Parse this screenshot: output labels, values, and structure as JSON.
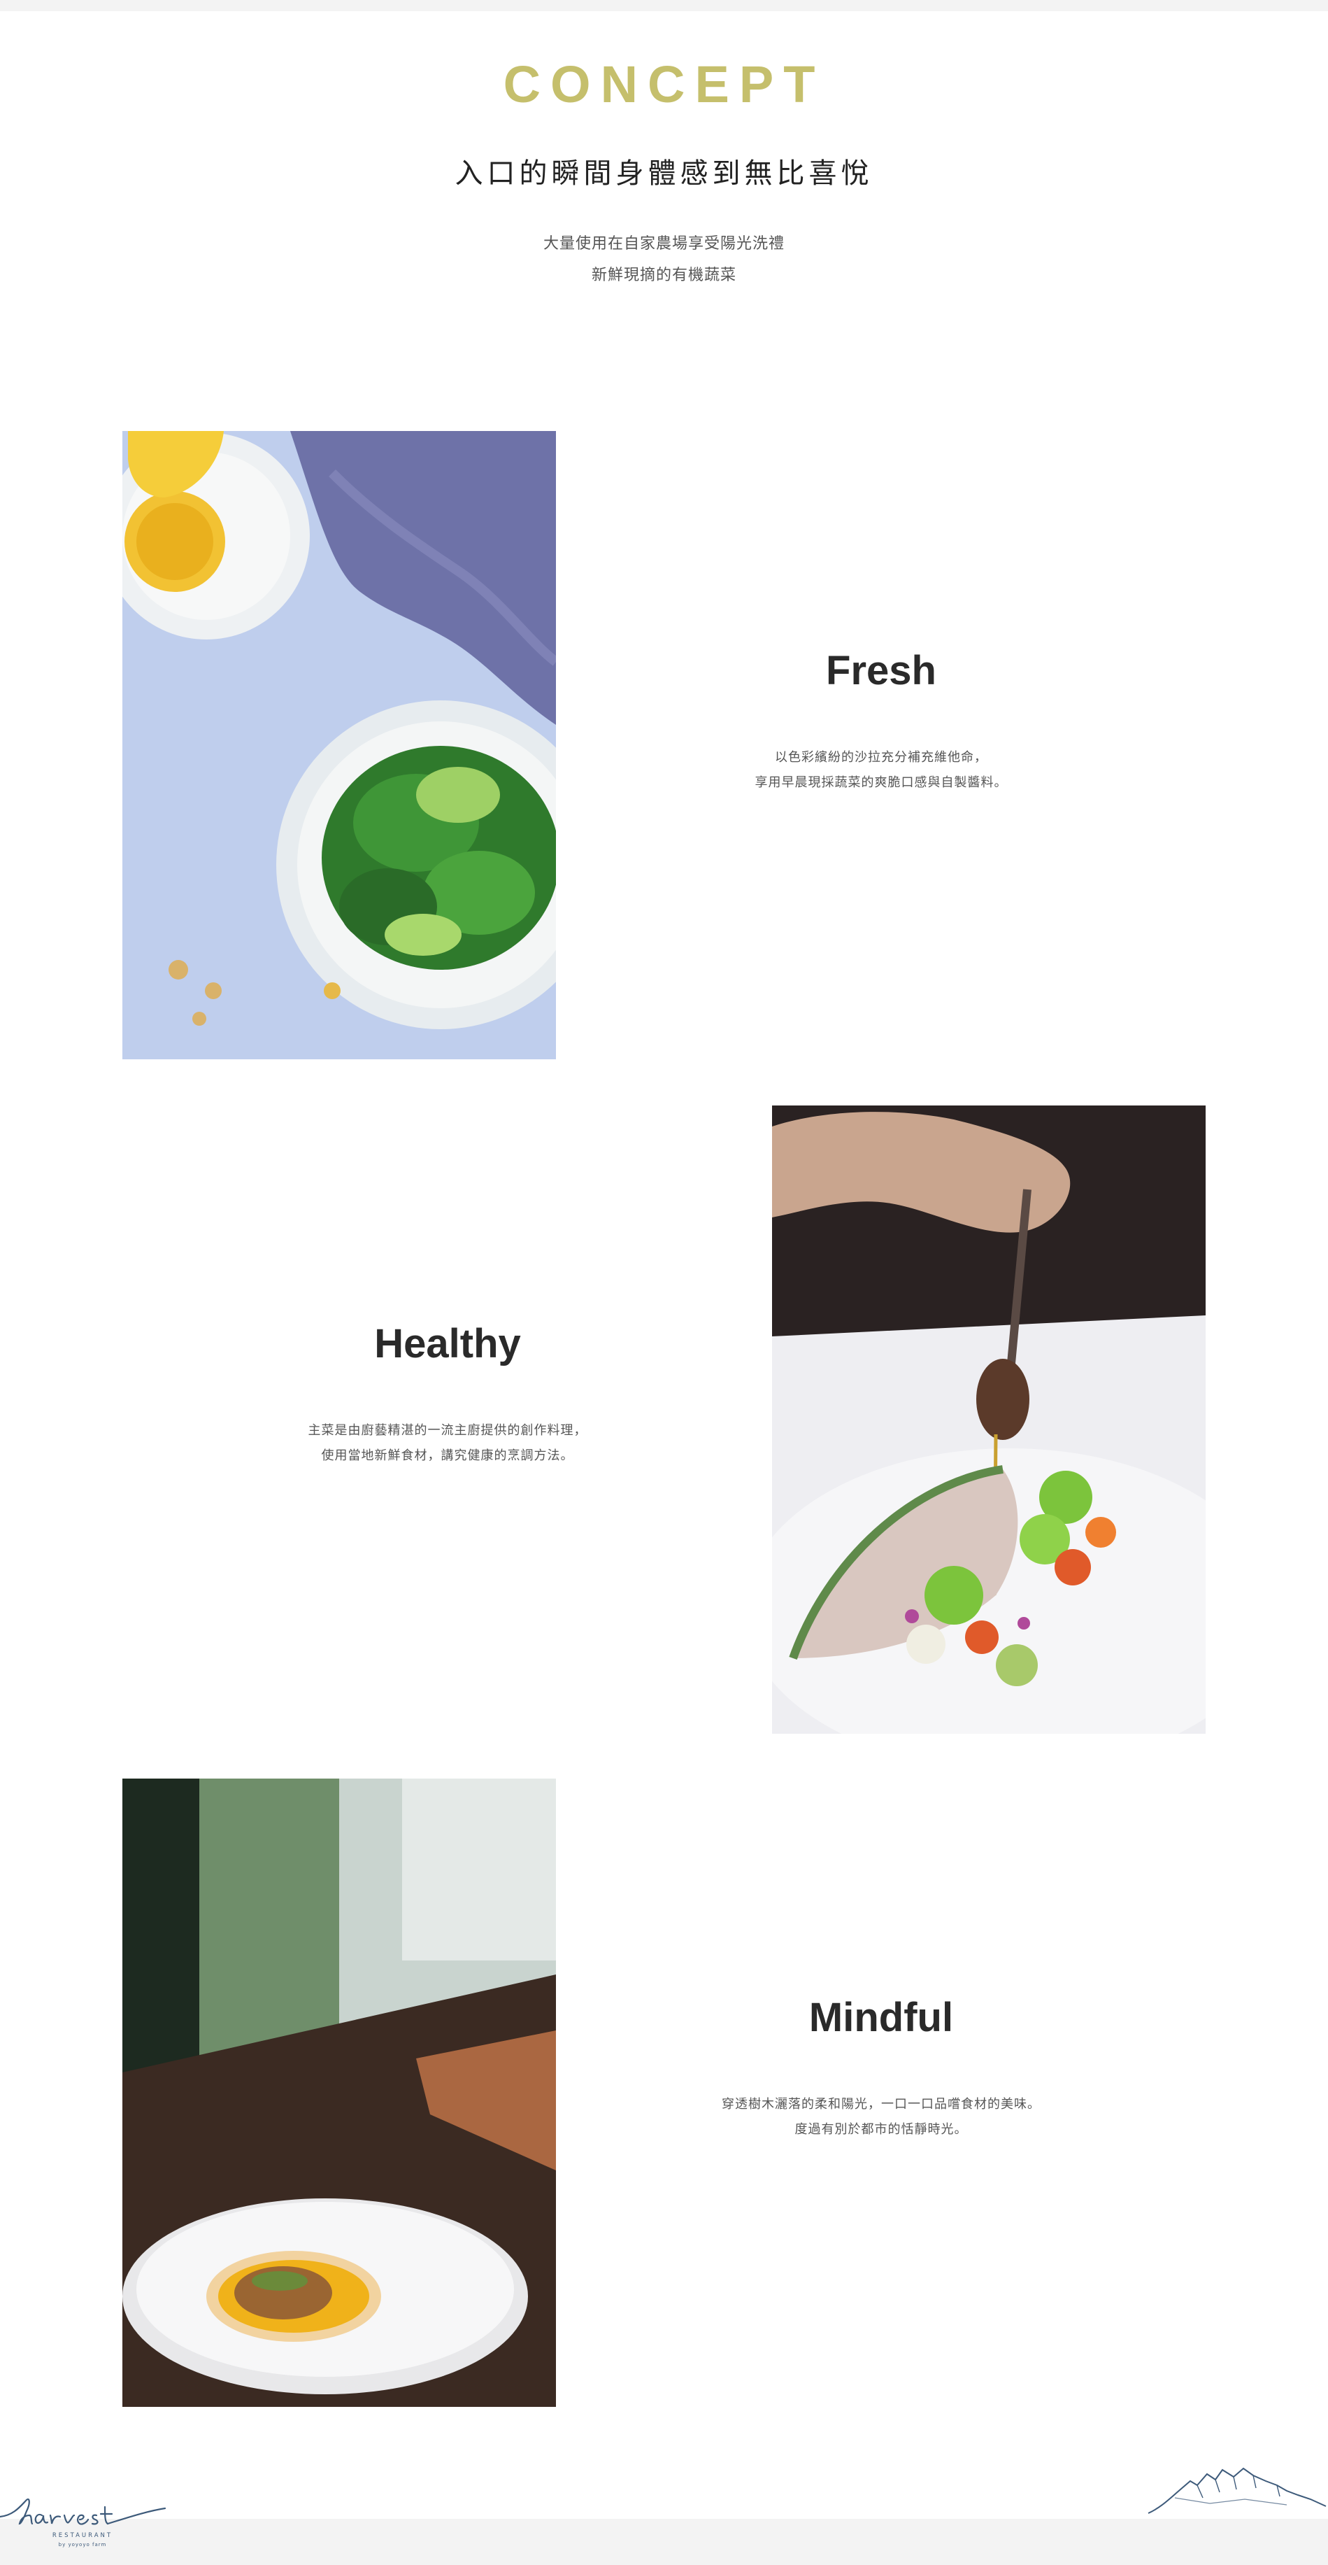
{
  "concept": {
    "title": "CONCEPT",
    "headline": "入口的瞬間身體感到無比喜悅",
    "intro_lines": [
      "大量使用在自家農場享受陽光洗禮",
      "新鮮現摘的有機蔬菜"
    ]
  },
  "features": [
    {
      "title": "Fresh",
      "desc_lines": [
        "以色彩繽紛的沙拉充分補充維他命，",
        "享用早晨現採蔬菜的爽脆口感與自製醬料。"
      ],
      "image_icon": "salad-photo"
    },
    {
      "title": "Healthy",
      "desc_lines": [
        "主菜是由廚藝精湛的一流主廚提供的創作料理，",
        "使用當地新鮮食材，講究健康的烹調方法。"
      ],
      "image_icon": "plating-photo"
    },
    {
      "title": "Mindful",
      "desc_lines": [
        "穿透樹木灑落的柔和陽光，一口一口品嚐食材的美味。",
        "度過有別於都市的恬靜時光。"
      ],
      "image_icon": "dish-photo"
    }
  ],
  "footer": {
    "logo_script": "harvest",
    "logo_sub": "RESTAURANT",
    "logo_tag": "by yoyoyo farm"
  },
  "colors": {
    "accent": "#c5bf6c",
    "logo": "#3d5a7a",
    "footer_bg": "#f3f3f3"
  }
}
